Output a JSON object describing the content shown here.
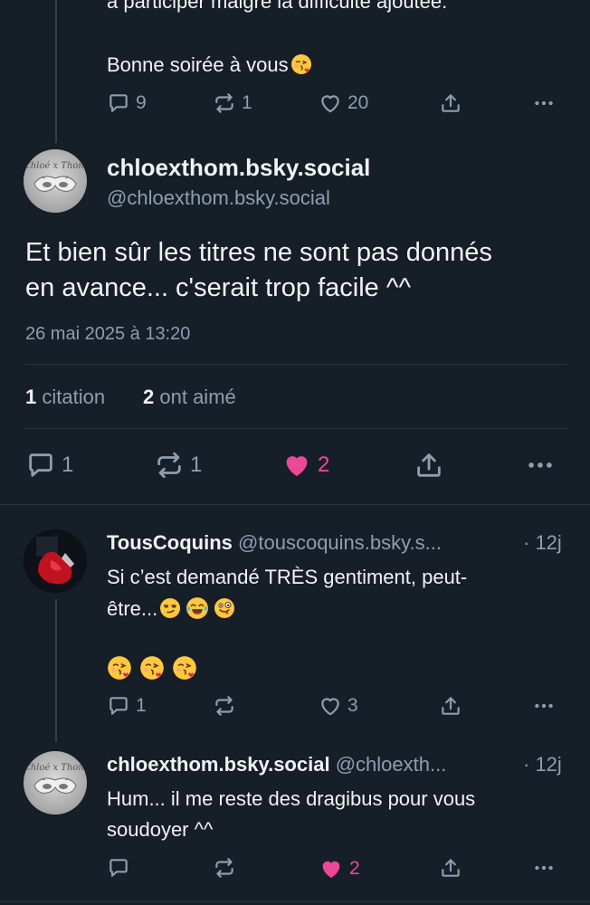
{
  "top_post": {
    "text_line1": "à participer malgré la difficulté ajoutée.",
    "text_line2": "Bonne soirée à vous",
    "replies": "9",
    "reposts": "1",
    "likes": "20"
  },
  "main_post": {
    "display_name": "chloexthom.bsky.social",
    "handle": "@chloexthom.bsky.social",
    "avatar_text": "Chloé x Thom",
    "text_line1": "Et bien sûr les titres ne sont pas donnés",
    "text_line2": "en avance... c'serait trop facile ^^",
    "timestamp": "26 mai 2025 à 13:20",
    "stats": {
      "quotes_count": "1",
      "quotes_label": "citation",
      "likes_count": "2",
      "likes_label": "ont aimé"
    },
    "replies": "1",
    "reposts": "1",
    "likes": "2"
  },
  "reply1": {
    "display_name": "TousCoquins",
    "handle": "@touscoquins.bsky.s...",
    "age": "· 12j",
    "text_line1": "Si c’est demandé TRÈS gentiment, peut-",
    "text_line2": "être...",
    "replies": "1",
    "likes": "3"
  },
  "reply2": {
    "display_name": "chloexthom.bsky.social",
    "handle": "@chloexth...",
    "age": "· 12j",
    "avatar_text": "Chloé x Thom",
    "text_line1": "Hum... il me reste des dragibus pour vous",
    "text_line2": "soudoyer ^^",
    "likes": "2"
  },
  "colors": {
    "background": "#161e27",
    "text": "#f1f3f5",
    "muted": "#8d9eb1",
    "like_active": "#ec4899"
  }
}
